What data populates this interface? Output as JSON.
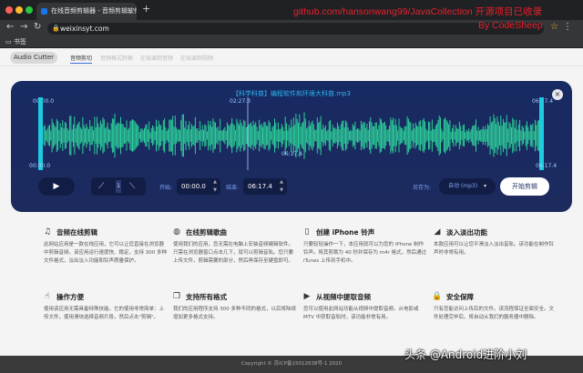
{
  "browser": {
    "tab_title": "在线音频剪辑器 - 音频剪辑软件",
    "tab_close": "×",
    "new_tab": "+",
    "url": "weixinsyt.com",
    "bookmarks_label": "书签",
    "overlay_line1": "github.com/hansonwang99/JavaCollection 开源项目已收录",
    "overlay_line2": "By CodeSheep"
  },
  "site": {
    "brand": "Audio Cutter",
    "nav": [
      "音频剪切",
      "音频格式转换",
      "在线录制音频",
      "在线录制视频"
    ]
  },
  "editor": {
    "file_title": "【科学科普】编程软件和环境大科普.mp3",
    "time_start_top": "00:00.0",
    "time_mid_top": "02:27.3",
    "time_end_top": "06:17.4",
    "time_start_bottom": "00:00.0",
    "time_mid_bottom": "06:17.4",
    "time_end_bottom": "06:17.4",
    "close": "×",
    "fade_value": "1",
    "start_label": "开始:",
    "start_value": "00:00.0",
    "end_label": "结束:",
    "end_value": "06:17.4",
    "save_as_label": "另存为:",
    "format_value": "自动 (mp3)",
    "start_button": "开始剪辑"
  },
  "features": [
    {
      "icon": "music-note-icon",
      "title": "音频在线剪辑",
      "desc": "此网站应用是一款在线应用，它可以让您直接在浏览器中剪辑音频。该应用运行速度快、稳定，支持 300 多种文件格式，淡出淡入功能和铃声质量保护。"
    },
    {
      "icon": "globe-icon",
      "title": "在线剪辑歌曲",
      "desc": "使用我们的应用，您无需在电脑上安装音频编辑软件。只需在浏览器窗口点击几下，就可以剪辑音轨。您只要上传文件，剪辑需要的部分，然后再保存至硬盘即可。"
    },
    {
      "icon": "phone-icon",
      "title": "创建 iPhone 铃声",
      "desc": "只要轻轻操作一下，本应用就可以为您的 iPhone 制作铃声。将其剪裁为 40 秒并保存为 m4r 格式，然后通过 iTunes 上传到手机中。"
    },
    {
      "icon": "fade-icon",
      "title": "淡入淡出功能",
      "desc": "本款应用可以让您平滑淡入淡出音轨。该功能在制作铃声时非常有用。"
    },
    {
      "icon": "hand-icon",
      "title": "操作方便",
      "desc": "使用该应用无需具备特殊技能。它的使用非常简单：上传文件，使用滑块选择音频片段，然后点击\"剪辑\"。"
    },
    {
      "icon": "files-icon",
      "title": "支持所有格式",
      "desc": "我们的应用程序支持 300 多种不同的格式，以后将陆续增加更多格式支持。"
    },
    {
      "icon": "video-icon",
      "title": "从视频中提取音频",
      "desc": "您可以使用此网站功能从视频中提取音频。从电影或 MTV 中获取音轨时，该功能非常有用。"
    },
    {
      "icon": "lock-icon",
      "title": "安全保障",
      "desc": "只有您能访问上传后的文件。该流程保证全面安全。文件处理完毕后，将自动从我们的服务器中删除。"
    }
  ],
  "footer": "Copyright © 苏ICP备15012638号-1 2020",
  "watermark": "头条 @Android进阶小刘",
  "colors": {
    "panel": "#1c2a5e",
    "wave": "#2fe3a0",
    "selection_handle": "#1ecbe1",
    "overlay_text": "#e8202a"
  }
}
